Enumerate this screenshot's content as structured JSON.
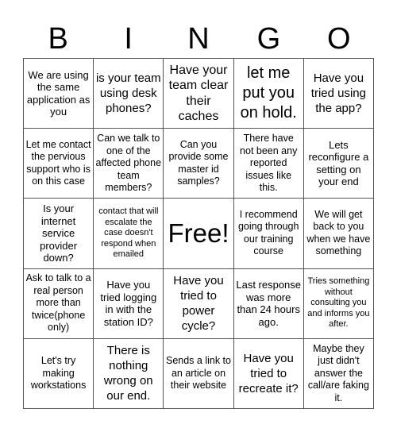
{
  "header": {
    "letters": [
      "B",
      "I",
      "N",
      "G",
      "O"
    ]
  },
  "cells": [
    [
      "We are using the same application as you",
      "is your team using desk phones?",
      "Have your team clear their caches",
      "let me put you on hold.",
      "Have you tried using the app?"
    ],
    [
      "Let me contact the pervious support who is on this case",
      "Can we talk to one of the affected phone team members?",
      "Can you provide some master id samples?",
      "There have not been any reported issues like this.",
      "Lets reconfigure a setting on your end"
    ],
    [
      "Is your internet service provider down?",
      "contact that will escalate the case doesn't respond when emailed",
      "Free!",
      "I recommend going through our training course",
      "We will get back to you when we have something"
    ],
    [
      "Ask to talk to a real person more than twice(phone only)",
      "Have you tried logging in with the station ID?",
      "Have you tried to power cycle?",
      "Last response was more than 24 hours ago.",
      "Tries something without consulting you and informs you after."
    ],
    [
      "Let's try making workstations",
      "There is nothing wrong on our end.",
      "Sends a link to an article on their website",
      "Have you tried to recreate it?",
      "Maybe they just didn't answer the call/are faking it."
    ]
  ]
}
